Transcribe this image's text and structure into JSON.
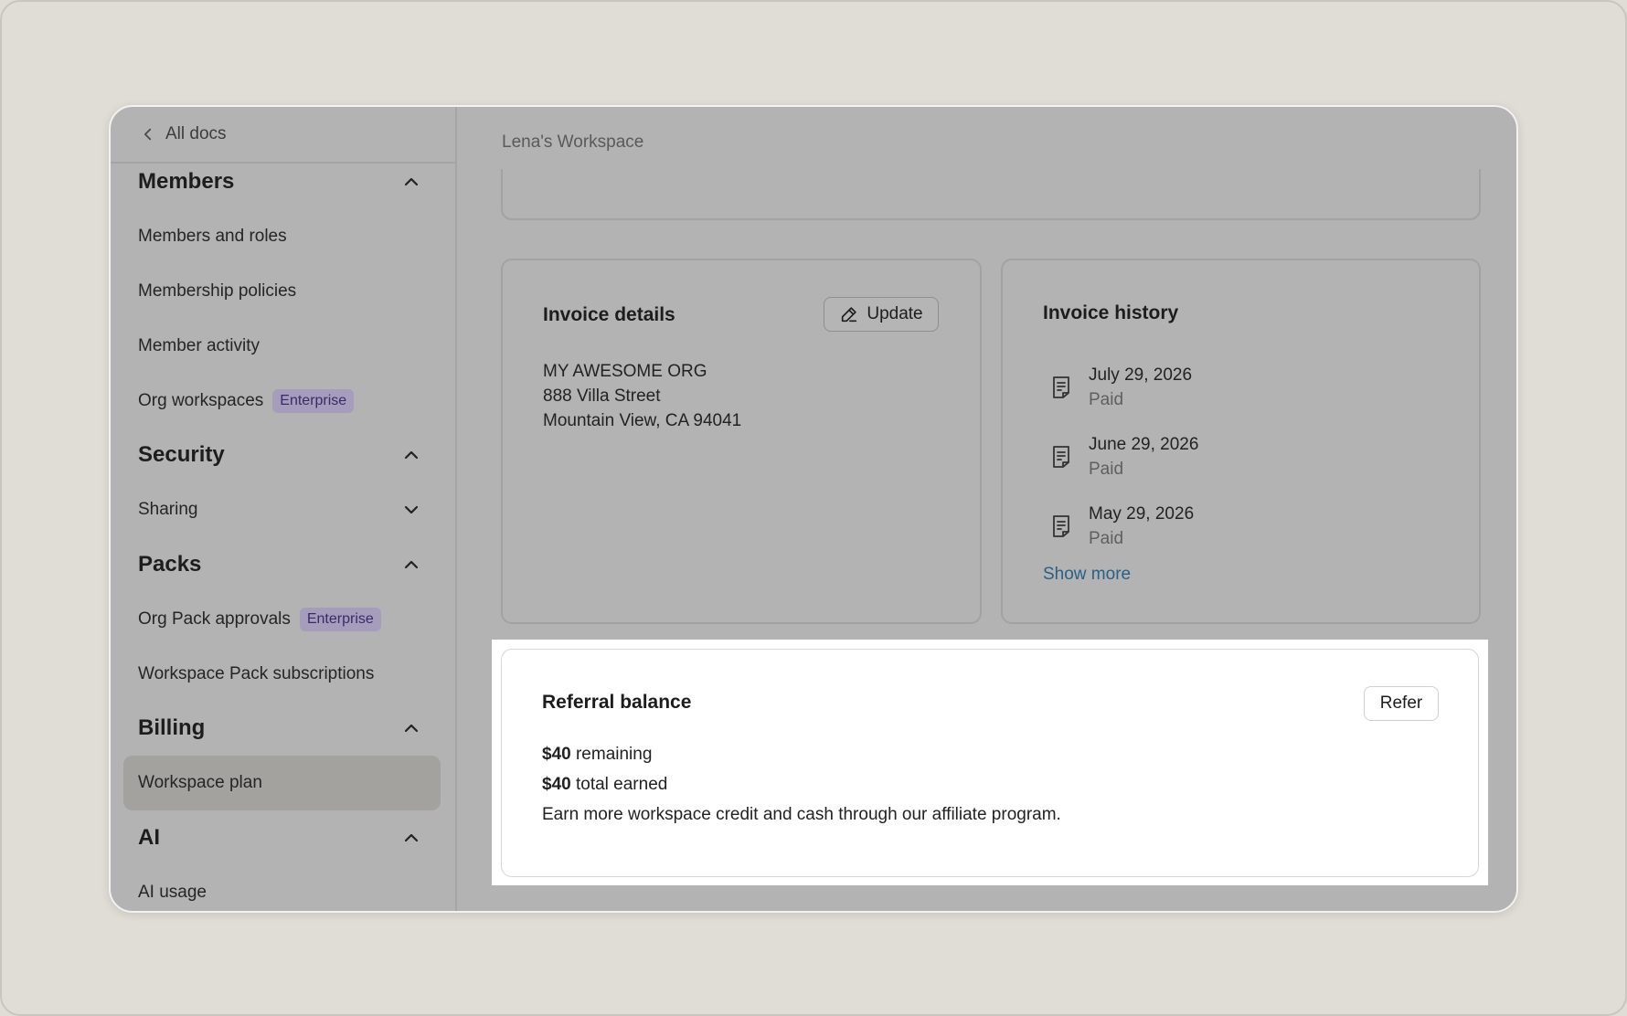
{
  "sidebar": {
    "back_label": "All docs",
    "sections": {
      "members": {
        "title": "Members",
        "items": [
          "Members and roles",
          "Membership policies",
          "Member activity",
          "Org workspaces"
        ],
        "org_workspaces_badge": "Enterprise"
      },
      "security": {
        "title": "Security",
        "items": [
          "Sharing"
        ]
      },
      "packs": {
        "title": "Packs",
        "items": [
          "Org Pack approvals",
          "Workspace Pack subscriptions"
        ],
        "org_pack_badge": "Enterprise"
      },
      "billing": {
        "title": "Billing",
        "items": [
          "Workspace plan"
        ]
      },
      "ai": {
        "title": "AI",
        "items": [
          "AI usage"
        ]
      }
    }
  },
  "main": {
    "workspace_title": "Lena's Workspace",
    "invoice_details": {
      "title": "Invoice details",
      "update_label": "Update",
      "address": [
        "MY AWESOME ORG",
        "888 Villa Street",
        "Mountain View, CA 94041"
      ]
    },
    "invoice_history": {
      "title": "Invoice history",
      "items": [
        {
          "date": "July 29, 2026",
          "status": "Paid"
        },
        {
          "date": "June 29, 2026",
          "status": "Paid"
        },
        {
          "date": "May 29, 2026",
          "status": "Paid"
        }
      ],
      "show_more": "Show more"
    },
    "referral": {
      "title": "Referral balance",
      "refer_label": "Refer",
      "remaining_amount": "$40",
      "remaining_text": "remaining",
      "earned_amount": "$40",
      "earned_text": "total earned",
      "description": "Earn more workspace credit and cash through our affiliate program."
    }
  },
  "colors": {
    "badge_bg": "#a59dbb",
    "badge_text": "#3b2a6a",
    "link": "#2a5f86",
    "active_item_bg": "#a3a29e"
  }
}
